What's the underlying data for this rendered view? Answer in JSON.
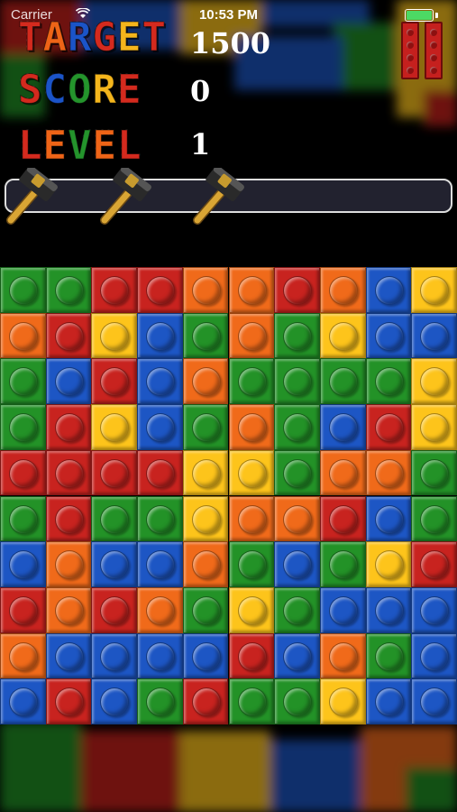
{
  "status_bar": {
    "carrier": "Carrier",
    "time": "10:53 PM",
    "battery_level": 1.0
  },
  "hud": {
    "target": {
      "label": "TARGET",
      "value": "1500"
    },
    "score": {
      "label": "SCORE",
      "value": "0"
    },
    "level": {
      "label": "LEVEL",
      "value": "1"
    }
  },
  "powerups": {
    "hammers_available": 3
  },
  "colors": {
    "red": "#c8231f",
    "orange": "#f06a1a",
    "yellow": "#fdc41b",
    "green": "#239227",
    "blue": "#1d56c4",
    "title_red": "#d42a1e",
    "title_blue": "#1b54c8",
    "title_yellow": "#f4b51c",
    "title_green": "#24942c",
    "title_orange": "#ee6417"
  },
  "board": {
    "rows": 10,
    "cols": 10,
    "grid": [
      [
        "G",
        "G",
        "R",
        "R",
        "O",
        "O",
        "R",
        "O",
        "B",
        "Y"
      ],
      [
        "O",
        "R",
        "Y",
        "B",
        "G",
        "O",
        "G",
        "Y",
        "B",
        "B"
      ],
      [
        "G",
        "B",
        "R",
        "B",
        "O",
        "G",
        "G",
        "G",
        "G",
        "Y"
      ],
      [
        "G",
        "R",
        "Y",
        "B",
        "G",
        "O",
        "G",
        "B",
        "R",
        "Y"
      ],
      [
        "R",
        "R",
        "R",
        "R",
        "Y",
        "Y",
        "G",
        "O",
        "O",
        "G"
      ],
      [
        "G",
        "R",
        "G",
        "G",
        "Y",
        "O",
        "O",
        "R",
        "B",
        "G"
      ],
      [
        "B",
        "O",
        "B",
        "B",
        "O",
        "G",
        "B",
        "G",
        "Y",
        "R"
      ],
      [
        "R",
        "O",
        "R",
        "O",
        "G",
        "Y",
        "G",
        "B",
        "B",
        "B"
      ],
      [
        "O",
        "B",
        "B",
        "B",
        "B",
        "R",
        "B",
        "O",
        "G",
        "B"
      ],
      [
        "B",
        "R",
        "B",
        "G",
        "R",
        "G",
        "G",
        "Y",
        "B",
        "B"
      ]
    ]
  }
}
